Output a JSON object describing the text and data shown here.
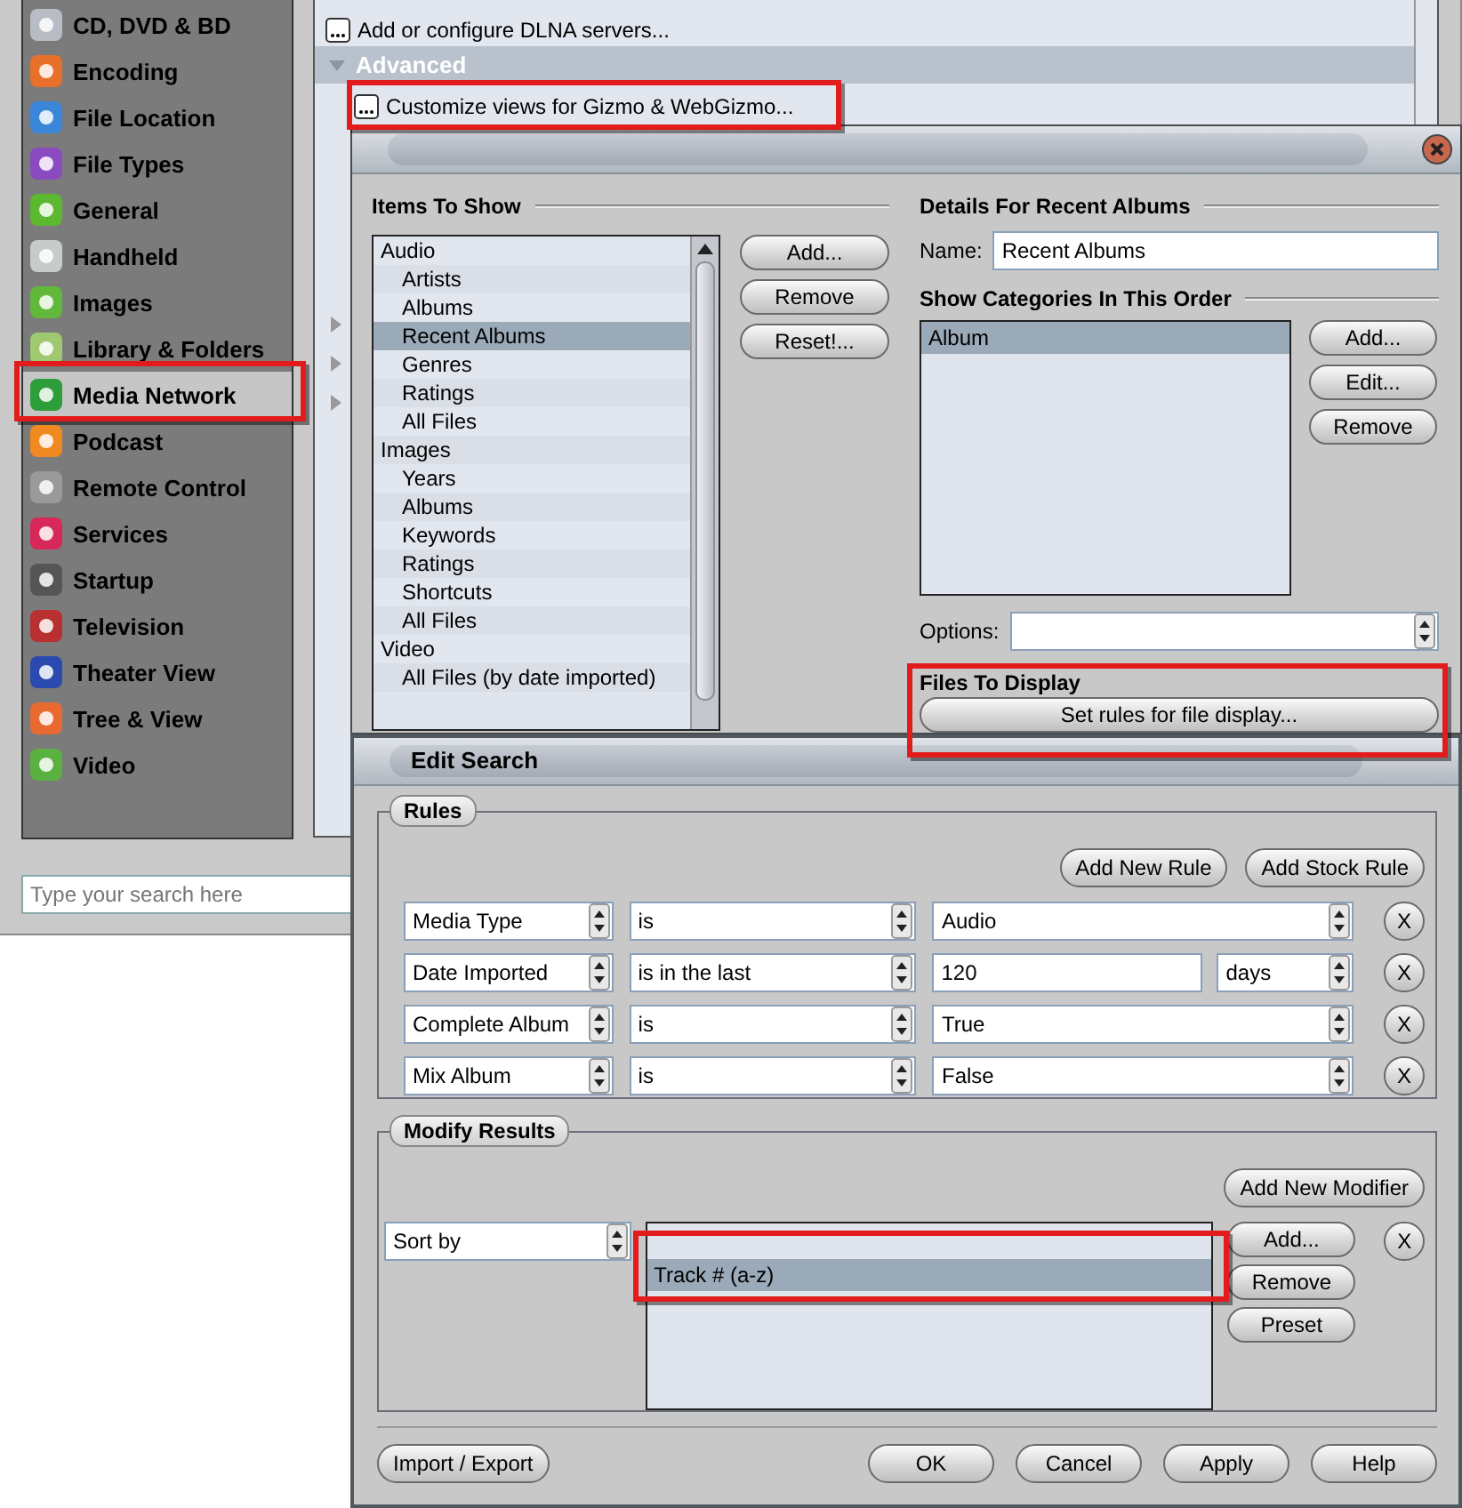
{
  "main_window": {
    "sidebar": {
      "items": [
        {
          "label": "CD, DVD & BD",
          "color": "#b8bcc4",
          "selected": false
        },
        {
          "label": "Encoding",
          "color": "#e8702a",
          "selected": false
        },
        {
          "label": "File Location",
          "color": "#3a86d8",
          "selected": false
        },
        {
          "label": "File Types",
          "color": "#8a4bc0",
          "selected": false
        },
        {
          "label": "General",
          "color": "#5cb82e",
          "selected": false
        },
        {
          "label": "Handheld",
          "color": "#c8ccc8",
          "selected": false
        },
        {
          "label": "Images",
          "color": "#62b83a",
          "selected": false
        },
        {
          "label": "Library & Folders",
          "color": "#9fc870",
          "selected": false
        },
        {
          "label": "Media Network",
          "color": "#2e9e3a",
          "selected": true
        },
        {
          "label": "Podcast",
          "color": "#f08a20",
          "selected": false
        },
        {
          "label": "Remote Control",
          "color": "#9a9a9a",
          "selected": false
        },
        {
          "label": "Services",
          "color": "#d8285a",
          "selected": false
        },
        {
          "label": "Startup",
          "color": "#555555",
          "selected": false
        },
        {
          "label": "Television",
          "color": "#b83030",
          "selected": false
        },
        {
          "label": "Theater View",
          "color": "#2a4ab0",
          "selected": false
        },
        {
          "label": "Tree & View",
          "color": "#e86a30",
          "selected": false
        },
        {
          "label": "Video",
          "color": "#5ab040",
          "selected": false
        }
      ]
    },
    "settings_rows": [
      {
        "kind": "action",
        "label": "Add or configure DLNA servers..."
      },
      {
        "kind": "section",
        "label": "Advanced",
        "expanded": true
      },
      {
        "kind": "action",
        "label": "Customize views for Gizmo & WebGizmo..."
      }
    ],
    "search": {
      "placeholder": "Type your search here"
    }
  },
  "customize_dialog": {
    "items_heading": "Items To Show",
    "items": [
      {
        "label": "Audio",
        "selected": false,
        "children": [
          {
            "label": "Artists",
            "selected": false
          },
          {
            "label": "Albums",
            "selected": false
          },
          {
            "label": "Recent Albums",
            "selected": true
          },
          {
            "label": "Genres",
            "selected": false
          },
          {
            "label": "Ratings",
            "selected": false
          },
          {
            "label": "All Files",
            "selected": false
          }
        ]
      },
      {
        "label": "Images",
        "selected": false,
        "children": [
          {
            "label": "Years",
            "selected": false
          },
          {
            "label": "Albums",
            "selected": false
          },
          {
            "label": "Keywords",
            "selected": false
          },
          {
            "label": "Ratings",
            "selected": false
          },
          {
            "label": "Shortcuts",
            "selected": false
          },
          {
            "label": "All Files",
            "selected": false
          }
        ]
      },
      {
        "label": "Video",
        "selected": false,
        "children": [
          {
            "label": "All Files (by date imported)",
            "selected": false
          }
        ]
      }
    ],
    "item_buttons": [
      "Add...",
      "Remove",
      "Reset!..."
    ],
    "details_heading": "Details For Recent Albums",
    "name_label": "Name:",
    "name_value": "Recent Albums",
    "categories_heading": "Show Categories In This Order",
    "categories": [
      {
        "label": "Album",
        "selected": true
      }
    ],
    "category_buttons": [
      "Add...",
      "Edit...",
      "Remove"
    ],
    "options_label": "Options:",
    "files_heading": "Files To Display",
    "files_button": "Set rules for file display..."
  },
  "edit_search": {
    "title": "Edit Search",
    "rules_label": "Rules",
    "rule_buttons": [
      "Add New Rule",
      "Add Stock Rule"
    ],
    "rules": [
      {
        "field": "Media Type",
        "operator": "is",
        "value": "Audio",
        "remove": "X"
      },
      {
        "field": "Date Imported",
        "operator": "is in the last",
        "value": "120",
        "unit": "days",
        "remove": "X"
      },
      {
        "field": "Complete Album",
        "operator": "is",
        "value": "True",
        "remove": "X"
      },
      {
        "field": "Mix Album",
        "operator": "is",
        "value": "False",
        "remove": "X"
      }
    ],
    "modify_label": "Modify Results",
    "add_modifier": "Add New Modifier",
    "sort_by": "Sort by",
    "modifiers": [
      {
        "label": "Track # (a-z)",
        "selected": true
      }
    ],
    "modifier_buttons": [
      "Add...",
      "Remove",
      "Preset"
    ],
    "modifier_remove": "X",
    "import_export": "Import / Export",
    "footer_buttons": [
      "OK",
      "Cancel",
      "Apply",
      "Help"
    ]
  }
}
